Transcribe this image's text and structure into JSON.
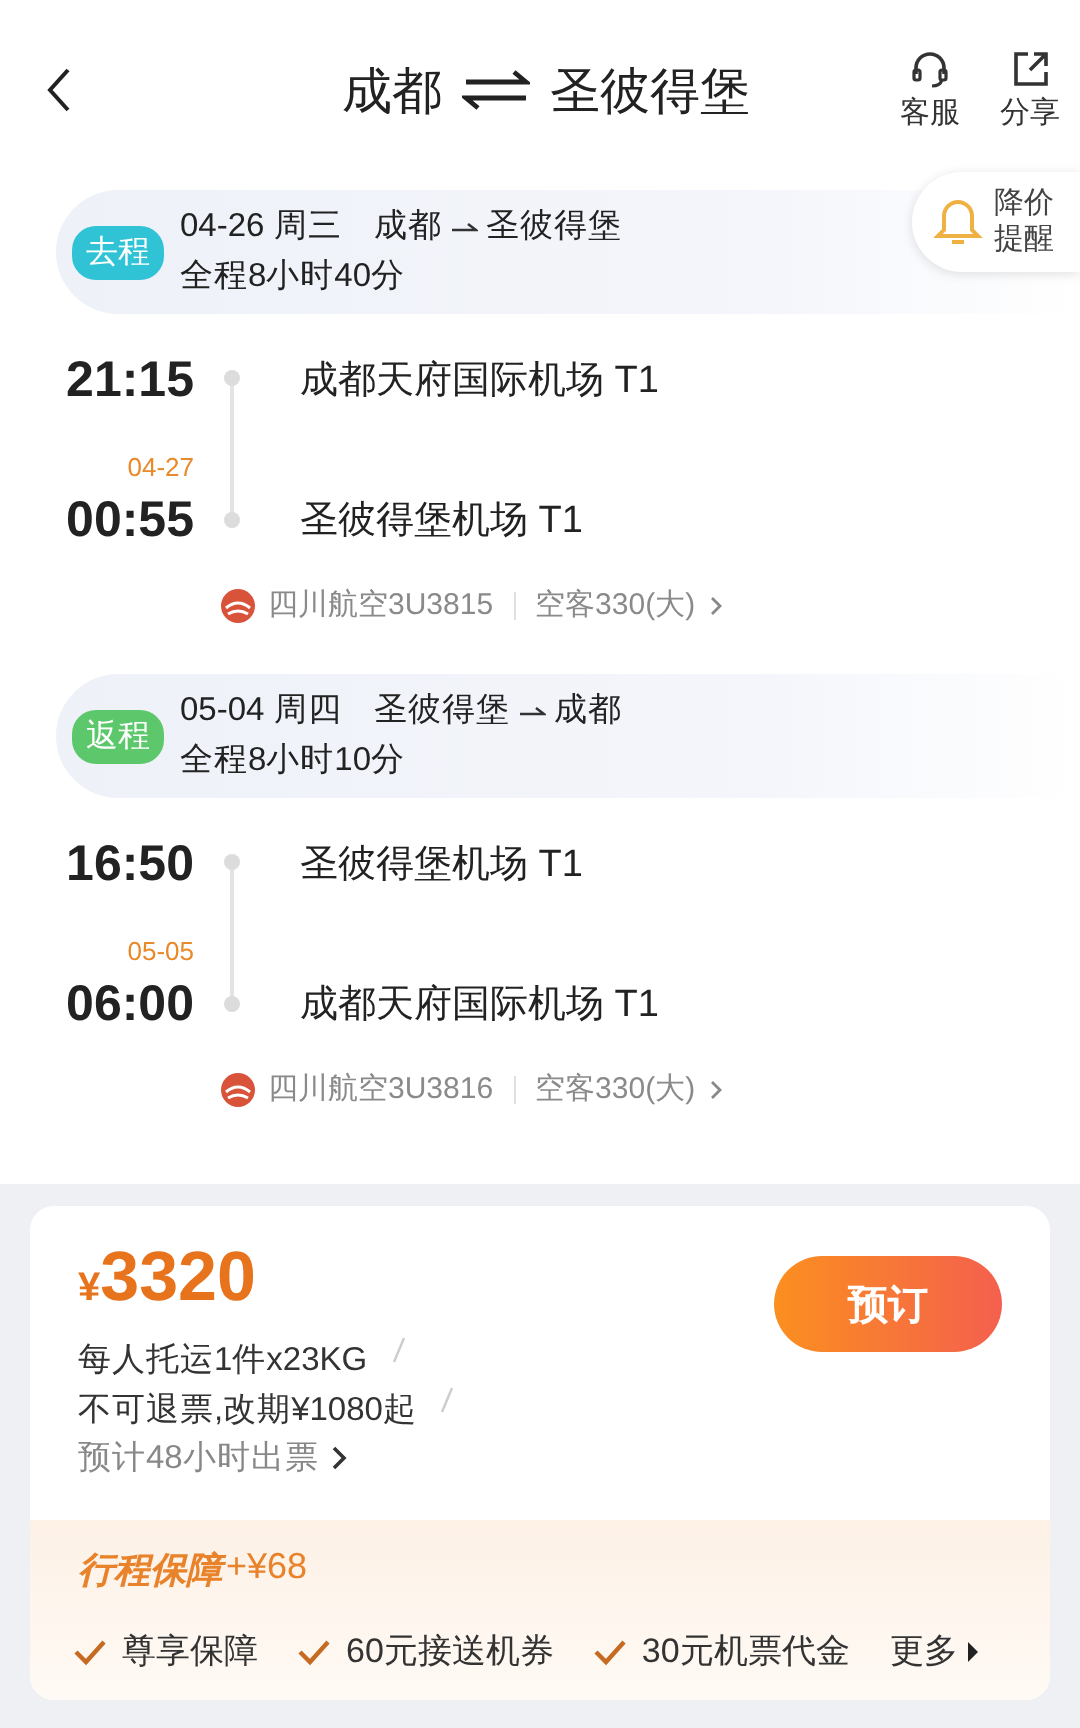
{
  "header": {
    "from": "成都",
    "to": "圣彼得堡",
    "actions": [
      {
        "label": "客服",
        "kind": "service"
      },
      {
        "label": "分享",
        "kind": "share"
      }
    ]
  },
  "price_alert": {
    "label": "降价提醒"
  },
  "trips": [
    {
      "badge": "去程",
      "color": "#2fc3d5",
      "date": "04-26 周三",
      "from": "成都",
      "to": "圣彼得堡",
      "duration": "全程8小时40分",
      "dep_time": "21:15",
      "dep_airport": "成都天府国际机场 T1",
      "arr_date": "04-27",
      "arr_time": "00:55",
      "arr_airport": "圣彼得堡机场 T1",
      "flight": "四川航空3U3815",
      "aircraft": "空客330(大)"
    },
    {
      "badge": "返程",
      "color": "#5cc86b",
      "date": "05-04 周四",
      "from": "圣彼得堡",
      "to": "成都",
      "duration": "全程8小时10分",
      "dep_time": "16:50",
      "dep_airport": "圣彼得堡机场 T1",
      "arr_date": "05-05",
      "arr_time": "06:00",
      "arr_airport": "成都天府国际机场 T1",
      "flight": "四川航空3U3816",
      "aircraft": "空客330(大)"
    }
  ],
  "price": {
    "currency": "¥",
    "amount": "3320",
    "book": "预订",
    "notes": [
      "每人托运1件x23KG",
      "不可退票,改期¥1080起"
    ],
    "ticketing": "预计48小时出票"
  },
  "insurance": {
    "title": "行程保障",
    "price": "+¥68",
    "features": [
      "尊享保障",
      "60元接送机券",
      "30元机票代金"
    ],
    "more": "更多"
  }
}
